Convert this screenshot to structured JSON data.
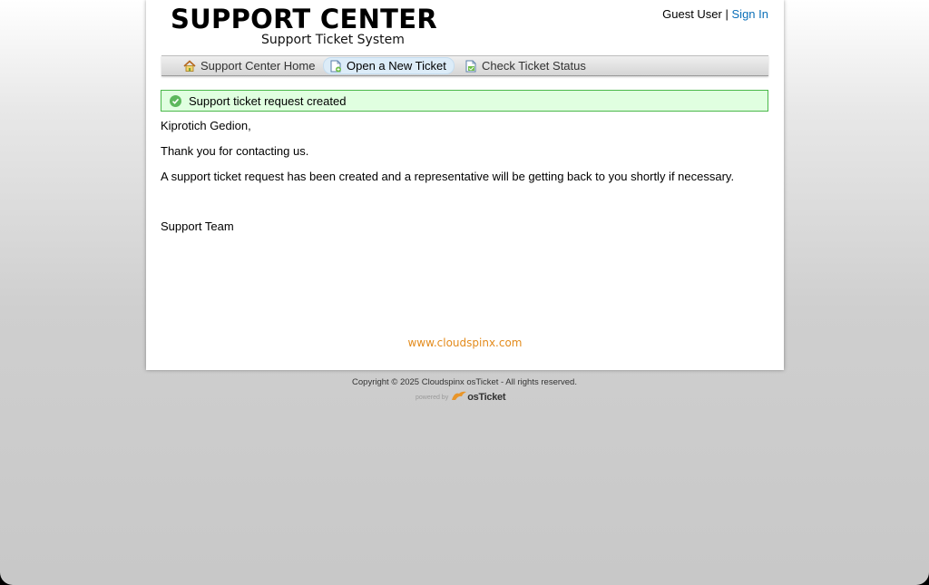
{
  "header": {
    "logo_title": "SUPPORT CENTER",
    "logo_subtitle": "Support Ticket System",
    "user_label": "Guest User",
    "separator": "|",
    "sign_in": "Sign In"
  },
  "nav": {
    "items": [
      {
        "label": "Support Center Home",
        "icon": "home-icon"
      },
      {
        "label": "Open a New Ticket",
        "icon": "new-ticket-icon",
        "active": true
      },
      {
        "label": "Check Ticket Status",
        "icon": "ticket-status-icon"
      }
    ]
  },
  "notice": {
    "message": "Support ticket request created",
    "icon": "check-circle-icon",
    "color": "#4ab84a"
  },
  "content": {
    "greeting": "Kiprotich Gedion,",
    "thanks": "Thank you for contacting us.",
    "body": "A support ticket request has been created and a representative will be getting back to you shortly if necessary.",
    "signature": "Support Team"
  },
  "watermark": "www.cloudspinx.com",
  "footer": {
    "copyright": "Copyright © 2025 Cloudspinx osTicket - All rights reserved.",
    "powered_by": "powered by",
    "brand": "osTicket"
  },
  "colors": {
    "link": "#0a6fb8",
    "watermark": "#e38b1c",
    "notice_bg": "#e0ffe0"
  }
}
